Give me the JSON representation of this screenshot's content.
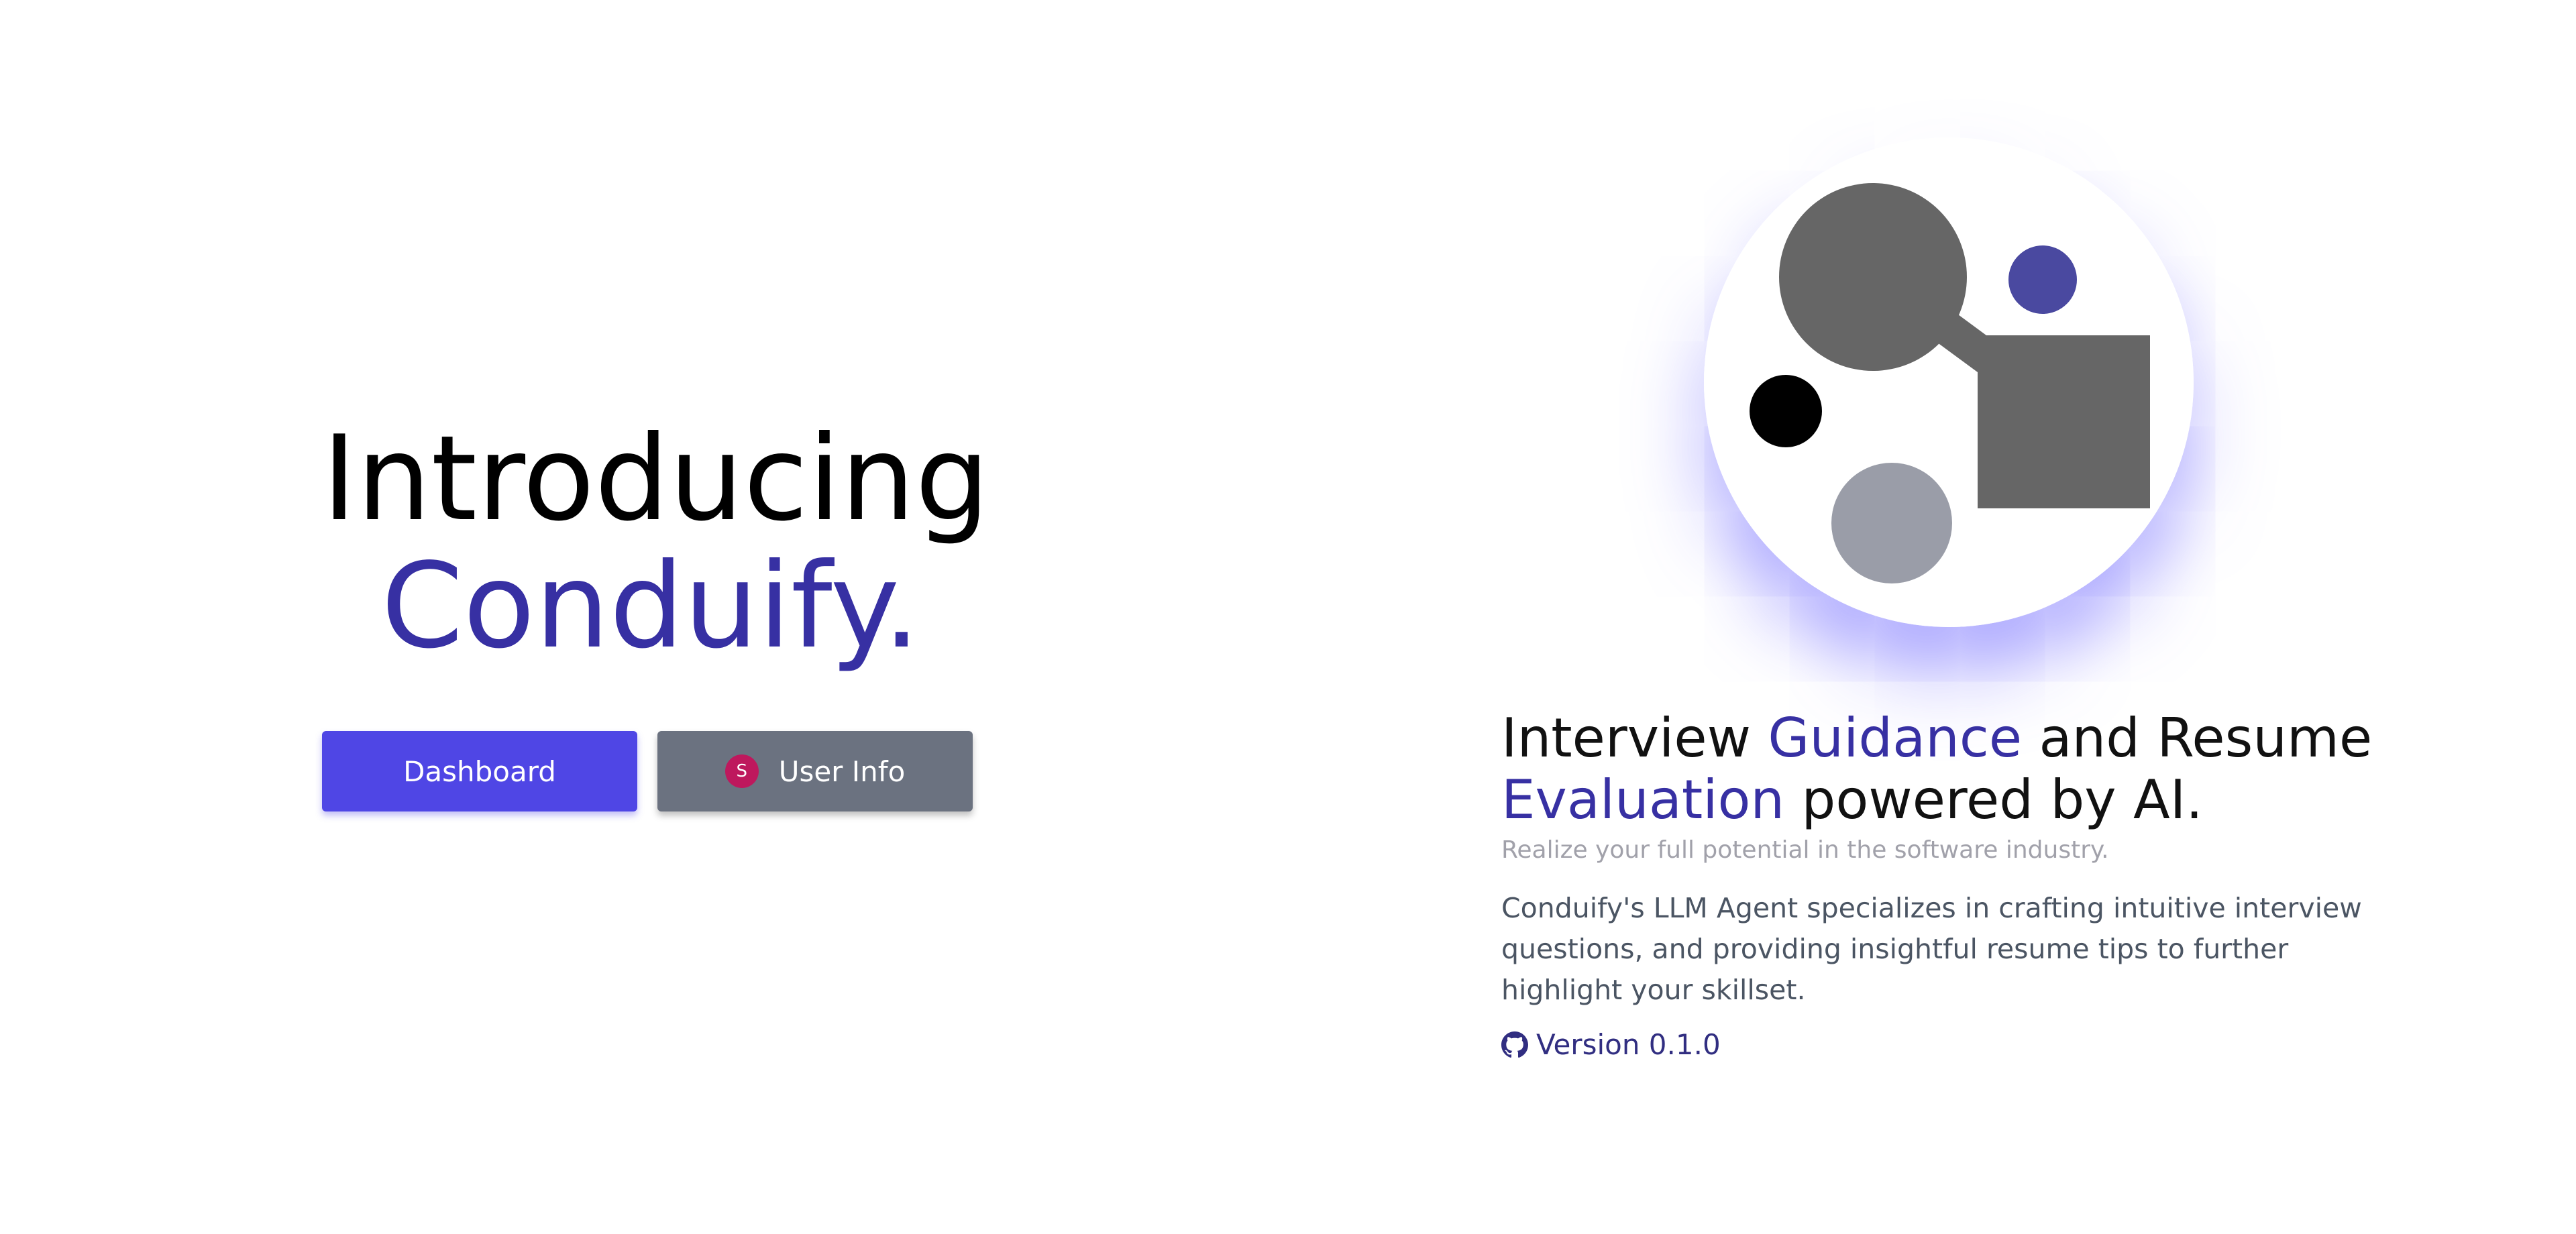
{
  "hero": {
    "title_line1": "Introducing",
    "title_line2": "Conduify.",
    "dashboard_label": "Dashboard",
    "user_info_label": "User Info",
    "avatar_initial": "S"
  },
  "info": {
    "heading_part1": "Interview ",
    "heading_accent1": "Guidance",
    "heading_part2": " and Resume ",
    "heading_accent2": "Evaluation",
    "heading_part3": " powered by AI.",
    "tagline": "Realize your full potential in the software industry.",
    "body": "Conduify's LLM Agent specializes in crafting intuitive interview questions, and providing insightful resume tips to further highlight your skillset.",
    "version_label": "Version 0.1.0"
  },
  "icons": {
    "github": "github-icon",
    "logo": "conduify-logo"
  },
  "colors": {
    "accent": "#3730a3",
    "primary_button": "#4f46e5",
    "secondary_button": "#6b7280",
    "avatar": "#be185d",
    "glow": "#635bff"
  }
}
